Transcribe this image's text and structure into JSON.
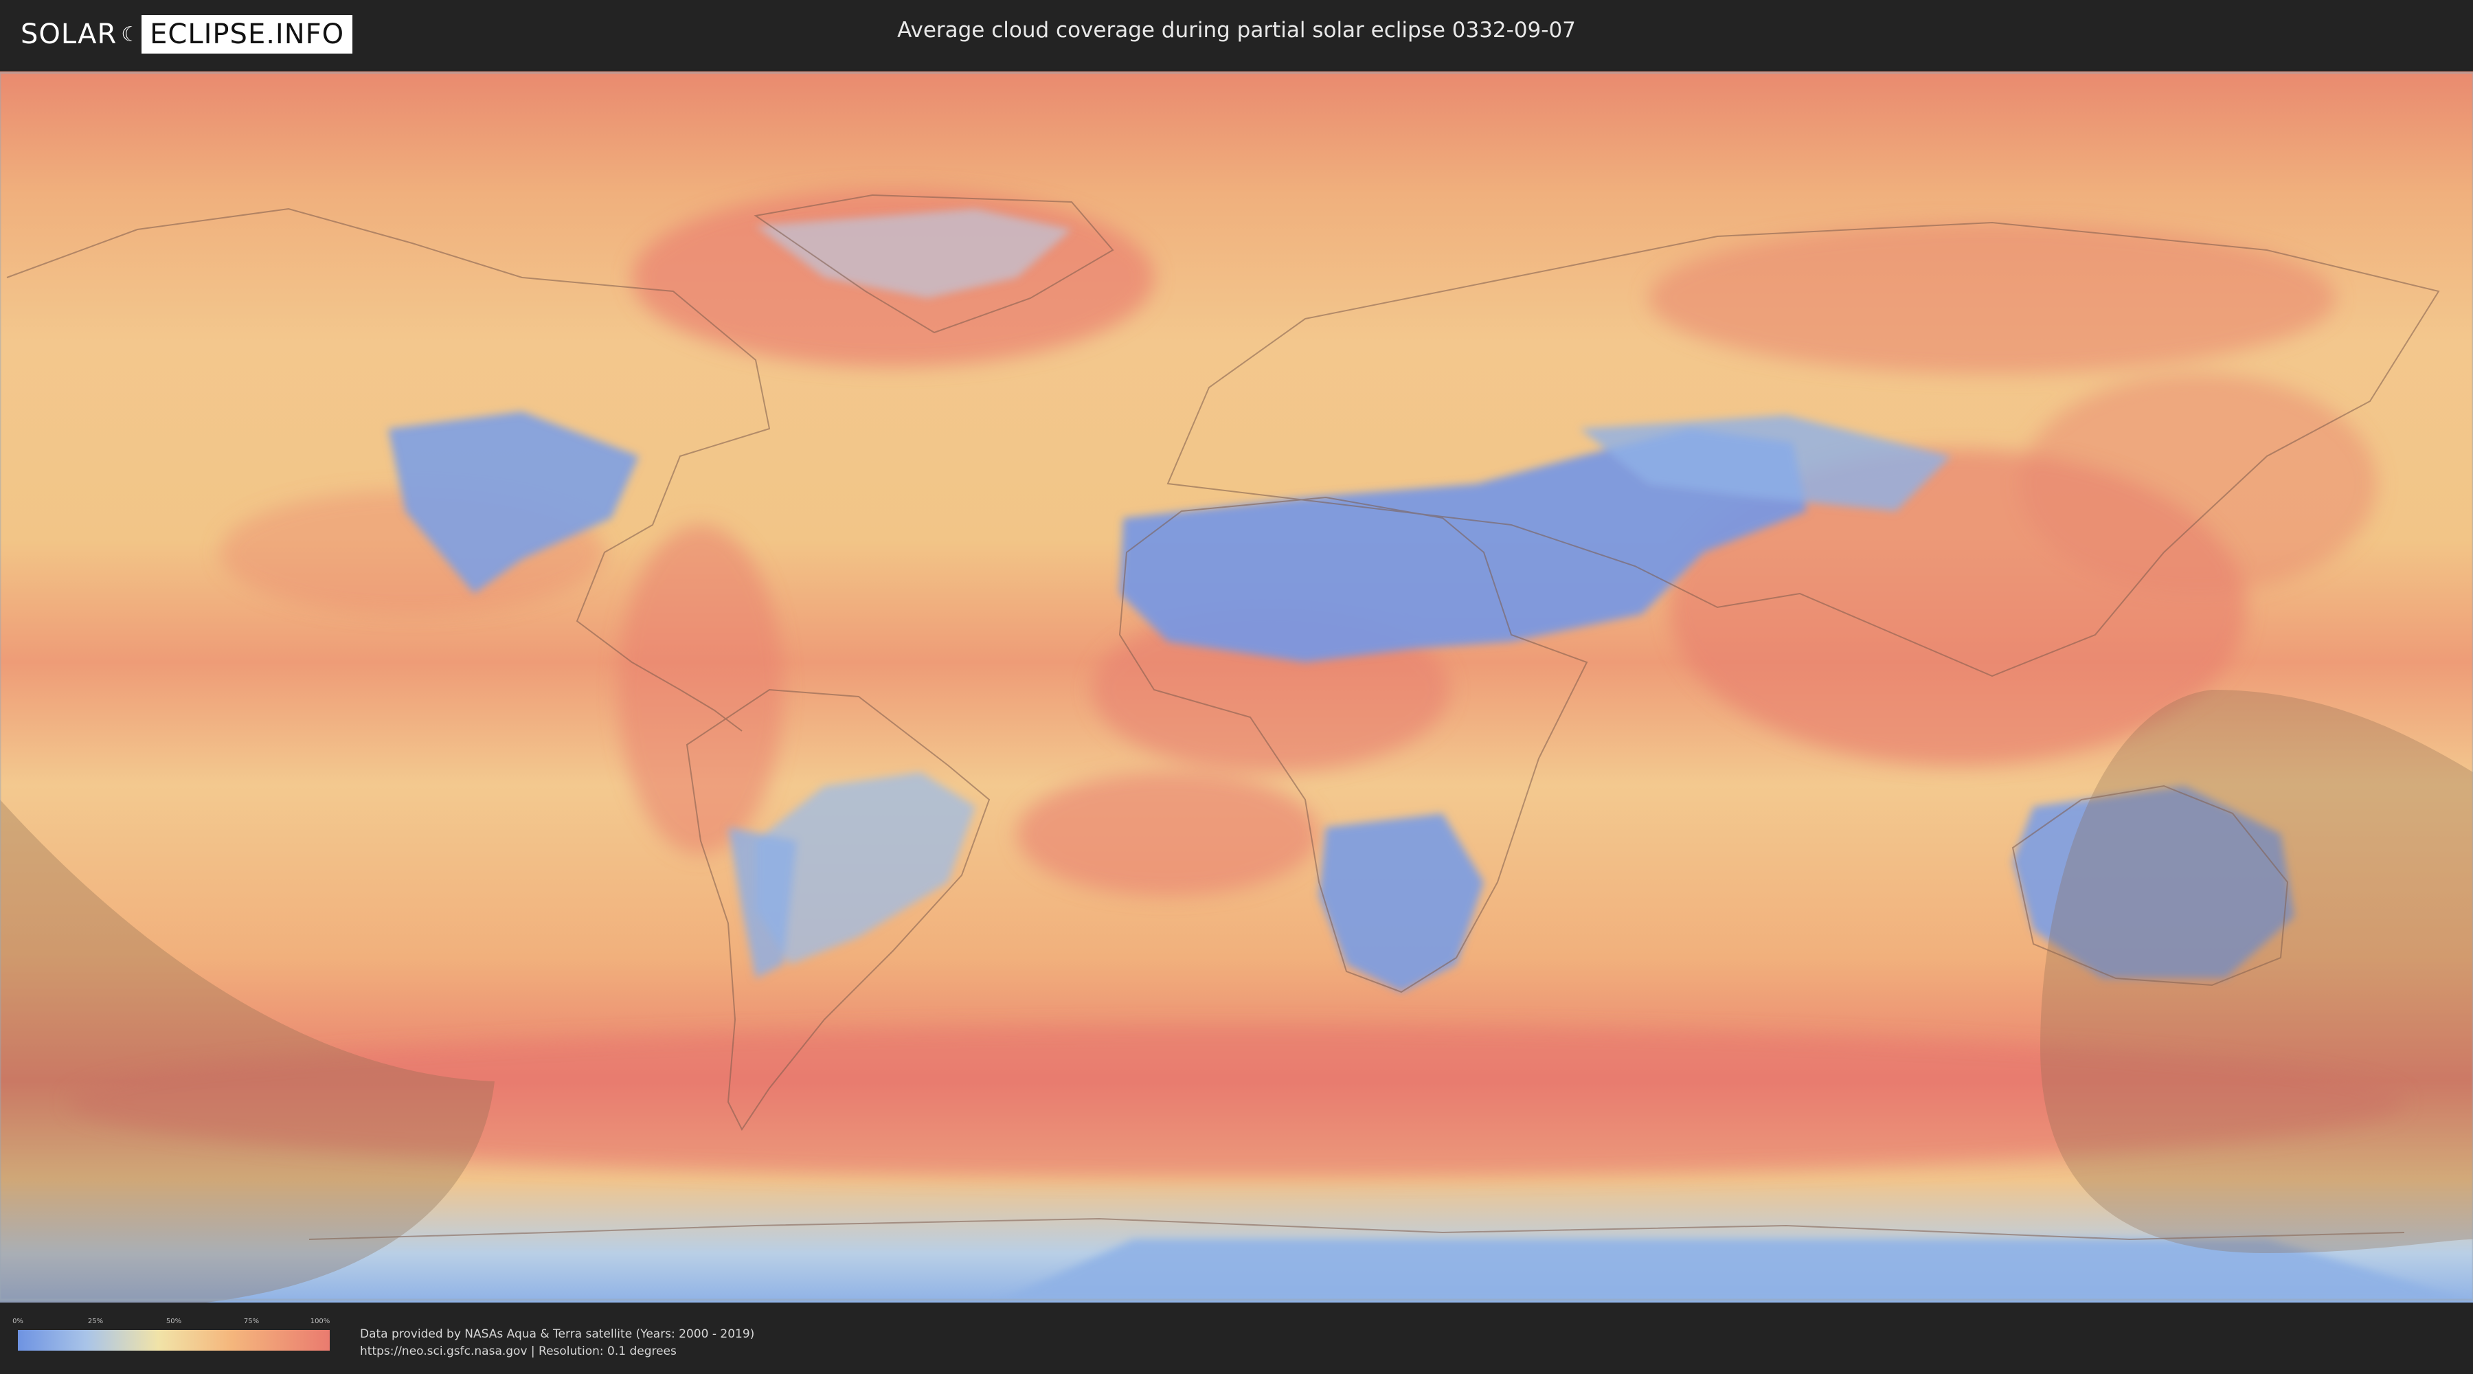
{
  "header": {
    "logo_part1": "SOLAR",
    "logo_part2": "ECLIPSE.INFO",
    "title": "Average cloud coverage during partial solar eclipse 0332-09-07"
  },
  "map": {
    "shadow_regions": [
      "eclipse-visibility-southwest",
      "eclipse-visibility-southeast"
    ],
    "colors": {
      "clear": "#6e93e2",
      "low": "#a9c4e8",
      "mid": "#f1e3a8",
      "high": "#f4b77d",
      "overcast": "#ea7b6f",
      "shadow": "#8a6a4e"
    }
  },
  "legend": {
    "ticks": [
      "0%",
      "25%",
      "50%",
      "75%",
      "100%"
    ]
  },
  "footer": {
    "credit_line1": "Data provided by NASAs Aqua & Terra satellite (Years: 2000 - 2019)",
    "credit_line2": "https://neo.sci.gsfc.nasa.gov | Resolution: 0.1 degrees"
  }
}
